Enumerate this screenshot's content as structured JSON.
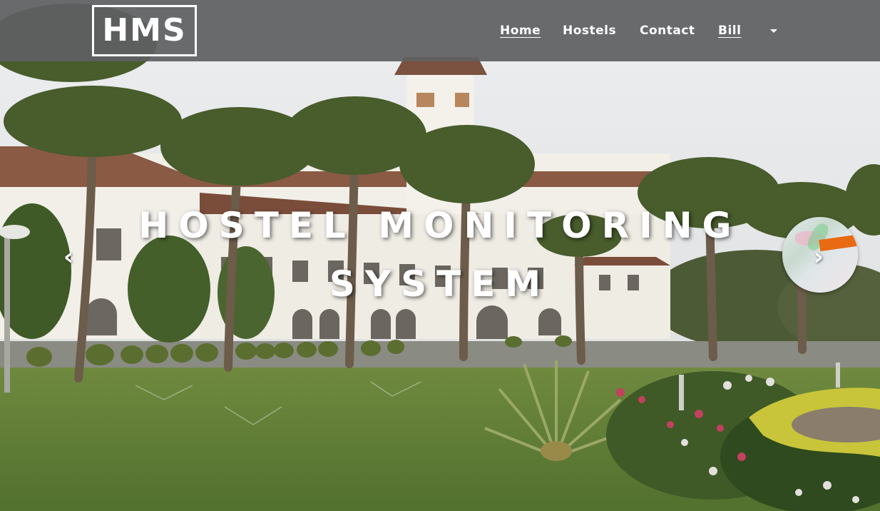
{
  "brand": {
    "logo_text": "HMS"
  },
  "nav": {
    "items": [
      {
        "label": "Home",
        "underlined": true
      },
      {
        "label": "Hostels",
        "underlined": false
      },
      {
        "label": "Contact",
        "underlined": false
      },
      {
        "label": "Bill",
        "underlined": true
      }
    ],
    "dropdown_icon": "caret-down-icon"
  },
  "hero": {
    "caption_line1": "HOSTEL MONITORING",
    "caption_line2": "SYSTEM",
    "prev_glyph": "‹",
    "next_glyph": "›",
    "prev_icon": "chevron-left-icon",
    "next_icon": "chevron-right-icon"
  },
  "colors": {
    "navbar": "#5f6062",
    "nav_text": "#ffffff",
    "caption_text": "#ffffff"
  }
}
